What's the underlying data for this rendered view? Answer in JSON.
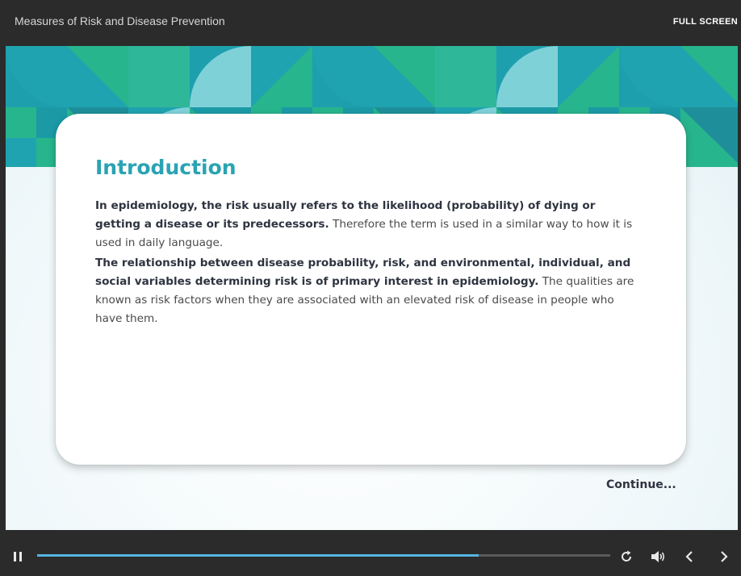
{
  "header": {
    "course_title": "Measures of Risk and Disease Prevention",
    "fullscreen_label": "FULL SCREEN"
  },
  "slide": {
    "title": "Introduction",
    "paragraphs": [
      {
        "bold": "In epidemiology, the risk usually refers to the likelihood (probability) of dying or getting a disease or its predecessors.",
        "normal": " Therefore the term is used in a similar way to how it is used in daily language."
      },
      {
        "bold": "The relationship between disease probability, risk, and environmental, individual, and social variables determining risk is of primary interest in epidemiology.",
        "normal": " The qualities are known as risk factors when they are associated with an elevated risk of disease in people who have them."
      }
    ],
    "continue_label": "Continue..."
  },
  "player": {
    "progress_fraction": 0.77,
    "icons": [
      "pause-icon",
      "replay-icon",
      "volume-icon",
      "chevron-left-icon",
      "chevron-right-icon"
    ]
  },
  "colors": {
    "accent_title": "#2aa3b3",
    "progress": "#56b4e2",
    "teal_dark": "#1b9aa6",
    "teal_green": "#27b58d",
    "teal_light": "#7fd1d8"
  }
}
